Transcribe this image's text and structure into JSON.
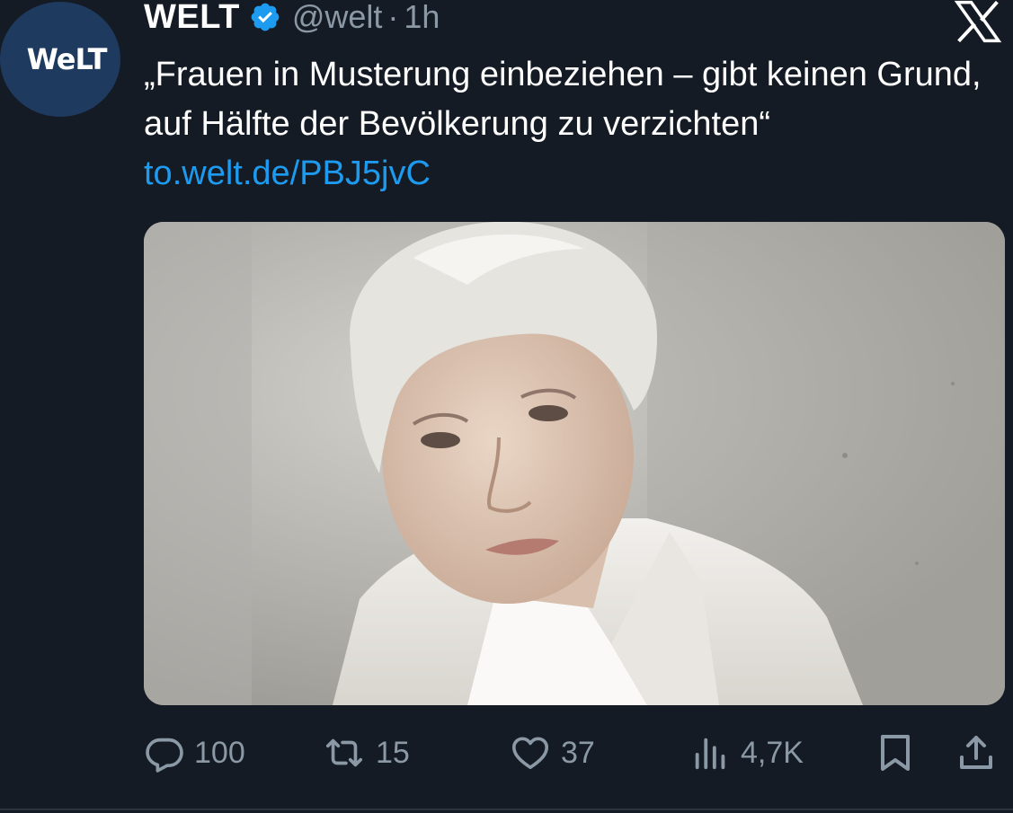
{
  "account": {
    "avatar_text": "WeLT",
    "name": "WELT",
    "handle": "@welt",
    "separator": "·",
    "time": "1h"
  },
  "tweet": {
    "text": "„Frauen in Musterung einbeziehen – gibt keinen Grund, auf Hälfte der Bevölkerung zu verzichten“",
    "link": "to.welt.de/PBJ5jvC"
  },
  "actions": {
    "replies": "100",
    "reposts": "15",
    "likes": "37",
    "views": "4,7K"
  },
  "icons": {
    "verified": "verified-badge-icon",
    "platform": "x-logo-icon",
    "reply": "reply-icon",
    "repost": "repost-icon",
    "like": "heart-icon",
    "views": "views-icon",
    "bookmark": "bookmark-icon",
    "share": "share-icon"
  },
  "colors": {
    "background": "#141b24",
    "link": "#1d9bf0",
    "verified": "#1d9bf0",
    "muted": "#8b98a5"
  }
}
